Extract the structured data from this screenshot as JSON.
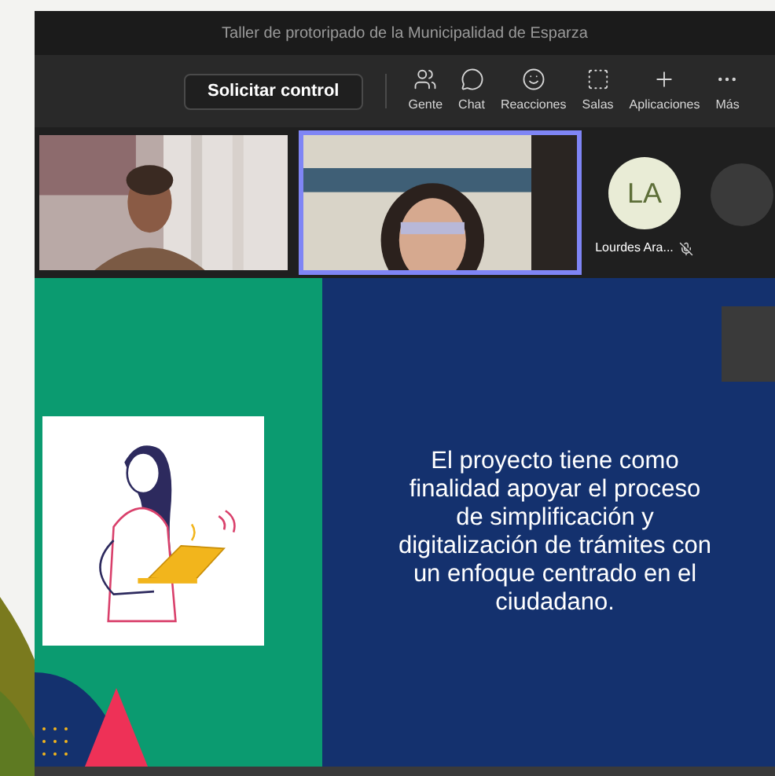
{
  "window": {
    "title": "Taller de protoripado de la Municipalidad de Esparza"
  },
  "toolbar": {
    "request_button": "Solicitar control",
    "tools": [
      {
        "label": "Gente"
      },
      {
        "label": "Chat"
      },
      {
        "label": "Reacciones"
      },
      {
        "label": "Salas"
      },
      {
        "label": "Aplicaciones"
      },
      {
        "label": "Más"
      }
    ]
  },
  "participants": [
    {
      "kind": "video",
      "selected": false
    },
    {
      "kind": "video",
      "selected": true
    },
    {
      "kind": "avatar",
      "initials": "LA",
      "name": "Lourdes Ara...",
      "muted": true
    },
    {
      "kind": "more"
    }
  ],
  "slide": {
    "text": "El proyecto tiene como finalidad apoyar el proceso de simplificación y digitalización de trámites con un enfoque centrado en el ciudadano."
  }
}
